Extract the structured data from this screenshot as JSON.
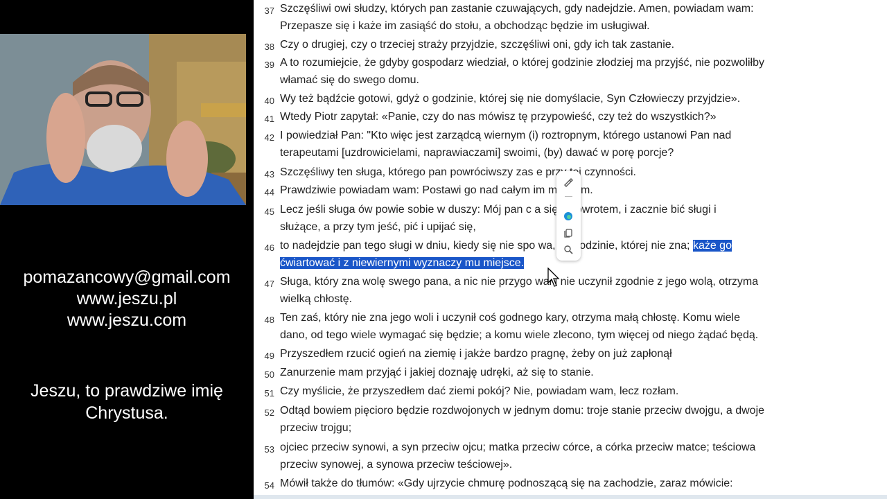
{
  "sidebar": {
    "email": "pomazancowy@gmail.com",
    "site1": "www.jeszu.pl",
    "site2": "www.jeszu.com",
    "tagline1": "Jeszu, to prawdziwe imię",
    "tagline2": "Chrystusa."
  },
  "verses": [
    {
      "num": "37",
      "lines": [
        "Szczęśliwi owi słudzy, których pan zastanie czuwających, gdy nadejdzie. Amen, powiadam wam:",
        "Przepasze się i każe im zasiąść do stołu, a obchodząc będzie im usługiwał."
      ]
    },
    {
      "num": "38",
      "lines": [
        "Czy o drugiej, czy o trzeciej straży przyjdzie, szczęśliwi oni, gdy ich tak zastanie."
      ]
    },
    {
      "num": "39",
      "lines": [
        "A to rozumiejcie, że gdyby gospodarz wiedział, o której godzinie złodziej ma przyjść, nie pozwoliłby",
        "włamać się do swego domu."
      ]
    },
    {
      "num": "40",
      "lines": [
        "Wy też bądźcie gotowi, gdyż o godzinie, której się nie domyślacie, Syn Człowieczy przyjdzie»."
      ]
    },
    {
      "num": "41",
      "lines": [
        "Wtedy Piotr zapytał: «Panie, czy do nas mówisz tę przypowieść, czy też do wszystkich?»"
      ]
    },
    {
      "num": "42",
      "lines": [
        " I powiedział Pan: \"Kto więc jest zarządcą wiernym (i) roztropnym, którego ustanowi Pan nad",
        "terapeutami [uzdrowicielami, naprawiaczami] swoimi, (by) dawać w porę porcje?"
      ]
    },
    {
      "num": "43",
      "lines": [
        " Szczęśliwy ten sługa, którego pan powróciwszy zas     e przy tej czynności."
      ]
    },
    {
      "num": "44",
      "lines": [
        " Prawdziwie powiadam wam: Postawi go nad całym       im mieniem."
      ]
    },
    {
      "num": "45",
      "lines": [
        " Lecz jeśli sługa ów powie sobie w duszy: Mój pan c     a się z powrotem, i zacznie bić sługi i",
        "służące, a przy tym jeść, pić i upijać się,"
      ]
    },
    {
      "num": "46",
      "lines": [
        "to nadejdzie pan tego sługi w dniu, kiedy się nie spo      wa, i o godzinie, której nie zna;",
        "ćwiartować i z niewiernymi wyznaczy mu miejsce."
      ],
      "selected_head": "każe go"
    },
    {
      "num": "47",
      "lines": [
        "Sługa, który zna wolę swego pana, a nic nie przygo      wał i nie uczynił zgodnie z jego wolą, otrzyma",
        "wielką chłostę."
      ]
    },
    {
      "num": "48",
      "lines": [
        "Ten zaś, który nie zna jego woli i uczynił coś godnego kary, otrzyma małą chłostę. Komu wiele",
        "dano, od tego wiele wymagać się będzie; a komu wiele zlecono, tym więcej od niego żądać będą."
      ]
    },
    {
      "num": "49",
      "lines": [
        "Przyszedłem rzucić ogień na ziemię i jakże bardzo pragnę, żeby on już zapłonął"
      ]
    },
    {
      "num": "50",
      "lines": [
        "Zanurzenie mam przyjąć i jakiej doznaję udręki, aż się to stanie."
      ]
    },
    {
      "num": "51",
      "lines": [
        "Czy myślicie, że przyszedłem dać ziemi pokój? Nie, powiadam wam, lecz rozłam."
      ]
    },
    {
      "num": "52",
      "lines": [
        "Odtąd bowiem pięcioro będzie rozdwojonych w jednym domu: troje stanie przeciw dwojgu, a dwoje",
        "przeciw trojgu;"
      ]
    },
    {
      "num": "53",
      "lines": [
        " ojciec przeciw synowi, a syn przeciw ojcu; matka przeciw córce, a córka przeciw matce; teściowa",
        "przeciw synowej, a synowa przeciw teściowej»."
      ]
    },
    {
      "num": "54",
      "lines": [
        "Mówił także do tłumów: «Gdy ujrzycie chmurę podnoszącą się na zachodzie, zaraz mówicie:"
      ]
    }
  ],
  "toolbar": {
    "icons": [
      "highlight-icon",
      "edge-copilot-icon",
      "copy-icon",
      "search-icon"
    ]
  },
  "colors": {
    "selection": "#1a56c8",
    "panel": "#000000",
    "document": "#ffffff"
  }
}
